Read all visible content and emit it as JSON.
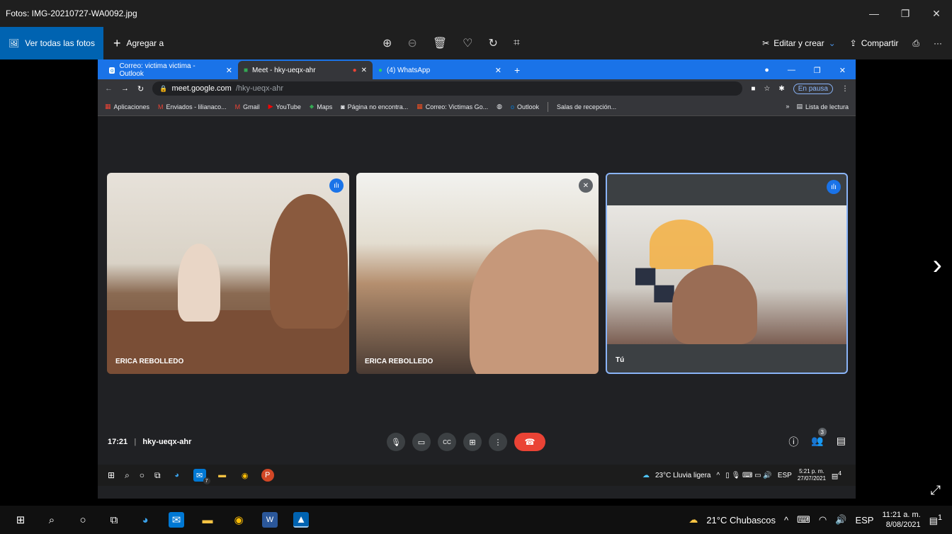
{
  "window": {
    "title": "Fotos: IMG-20210727-WA0092.jpg",
    "minimize": "—",
    "maximize": "❐",
    "close": "✕"
  },
  "photos_toolbar": {
    "view_all": "Ver todas las fotos",
    "add_to": "Agregar a",
    "edit_create": "Editar y crear",
    "share": "Compartir",
    "more": "···"
  },
  "browser": {
    "tabs": [
      {
        "label": "Correo: victima victima - Outlook"
      },
      {
        "label": "Meet - hky-ueqx-ahr"
      },
      {
        "label": "(4) WhatsApp"
      }
    ],
    "url_host": "meet.google.com",
    "url_path": "/hky-ueqx-ahr",
    "profile_status": "En pausa",
    "bookmarks": [
      "Aplicaciones",
      "Enviados - lilianaco...",
      "Gmail",
      "YouTube",
      "Maps",
      "Página no encontra...",
      "Correo: Victimas Go...",
      "Outlook",
      "Salas de recepción..."
    ],
    "reading_list": "Lista de lectura"
  },
  "meet": {
    "participants": [
      {
        "name": "ERICA REBOLLEDO"
      },
      {
        "name": "ERICA REBOLLEDO"
      },
      {
        "name": "Tú"
      }
    ],
    "time": "17:21",
    "meeting_code": "hky-ueqx-ahr",
    "people_count": "3"
  },
  "inner_taskbar": {
    "weather": "23°C Lluvia ligera",
    "lang": "ESP",
    "time": "5:21 p. m.",
    "date": "27/07/2021",
    "notif": "4",
    "mail_badge": "7"
  },
  "taskbar": {
    "weather": "21°C Chubascos",
    "lang": "ESP",
    "time": "11:21 a. m.",
    "date": "8/08/2021",
    "notif": "1"
  },
  "colors": {
    "accent": "#0063b1",
    "chrome_tabbar": "#1a73e8",
    "end_call": "#ea4335",
    "active_speaker": "#8ab4f8"
  }
}
